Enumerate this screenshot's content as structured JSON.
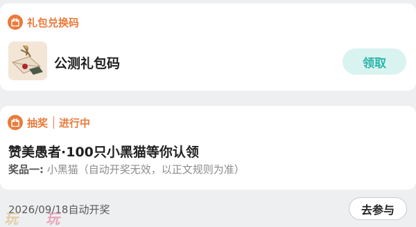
{
  "gift_section": {
    "title": "礼包兑换码",
    "item_name": "公测礼包码",
    "claim_label": "领取"
  },
  "lottery_section": {
    "title": "抽奖",
    "status": "进行中",
    "event_title": "赞美愚者·100只小黑猫等你认领",
    "prize_label": "奖品一:",
    "prize_value": "小黑猫（自动开奖无效，以正文规则为准）",
    "draw_time": "2026/09/18自动开奖",
    "join_label": "去参与"
  },
  "watermark": {
    "left_text": "玩",
    "right_text": "玩"
  },
  "colors": {
    "accent_orange": "#ea7a3b",
    "accent_teal": "#2cb5a8",
    "teal_button_bg": "#d9f3f1",
    "page_bg": "#eeeff1"
  }
}
